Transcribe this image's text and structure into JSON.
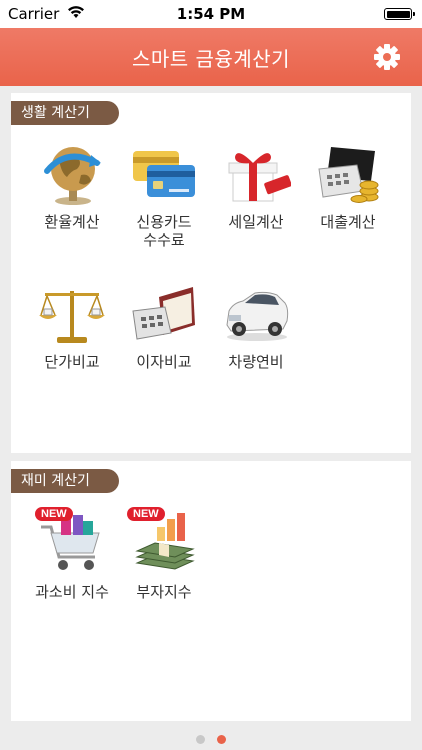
{
  "status_bar": {
    "carrier": "Carrier",
    "time": "1:54 PM"
  },
  "header": {
    "title": "스마트 금융계산기",
    "settings_icon": "gear-icon"
  },
  "sections": [
    {
      "title": "생활 계산기",
      "items": [
        {
          "label": "환율계산",
          "icon": "globe-icon"
        },
        {
          "label": "신용카드\n수수료",
          "icon": "credit-card-icon"
        },
        {
          "label": "세일계산",
          "icon": "gift-box-icon"
        },
        {
          "label": "대출계산",
          "icon": "calculator-coins-icon"
        },
        {
          "label": "단가비교",
          "icon": "balance-scale-icon"
        },
        {
          "label": "이자비교",
          "icon": "calculator-notebook-icon"
        },
        {
          "label": "차량연비",
          "icon": "car-icon"
        }
      ]
    },
    {
      "title": "재미 계산기",
      "items": [
        {
          "label": "과소비 지수",
          "icon": "shopping-cart-icon",
          "badge": "NEW"
        },
        {
          "label": "부자지수",
          "icon": "money-stack-icon",
          "badge": "NEW"
        }
      ]
    }
  ],
  "pager": {
    "pages": 2,
    "active": 2
  },
  "colors": {
    "header": "#e9634a",
    "section_tag": "#7b5a44",
    "badge": "#e0202d"
  }
}
